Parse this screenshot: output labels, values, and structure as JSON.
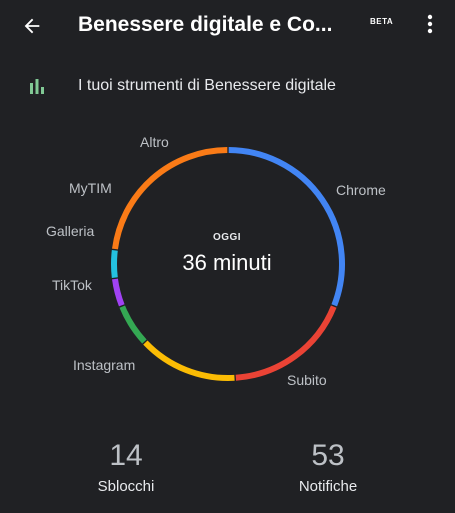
{
  "header": {
    "back_icon": "arrow-back-icon",
    "title": "Benessere digitale e Co...",
    "badge": "BETA",
    "more_icon": "more-vert-icon"
  },
  "tools": {
    "icon": "bar-chart-icon",
    "label": "I tuoi strumenti di Benessere digitale",
    "accent": "#81c995"
  },
  "usage": {
    "period_label": "OGGI",
    "total_label": "36 minuti",
    "segments": [
      {
        "app": "Chrome",
        "color": "#4285f4",
        "share": 0.31
      },
      {
        "app": "Subito",
        "color": "#ea4335",
        "share": 0.18
      },
      {
        "app": "Instagram",
        "color": "#fbbc04",
        "share": 0.14
      },
      {
        "app": "TikTok",
        "color": "#34a853",
        "share": 0.06
      },
      {
        "app": "Galleria",
        "color": "#a142f4",
        "share": 0.04
      },
      {
        "app": "MyTIM",
        "color": "#24c1e0",
        "share": 0.04
      },
      {
        "app": "Altro",
        "color": "#fa7b17",
        "share": 0.23
      }
    ]
  },
  "stats": {
    "unlocks_value": "14",
    "unlocks_label": "Sblocchi",
    "notifications_value": "53",
    "notifications_label": "Notifiche"
  }
}
